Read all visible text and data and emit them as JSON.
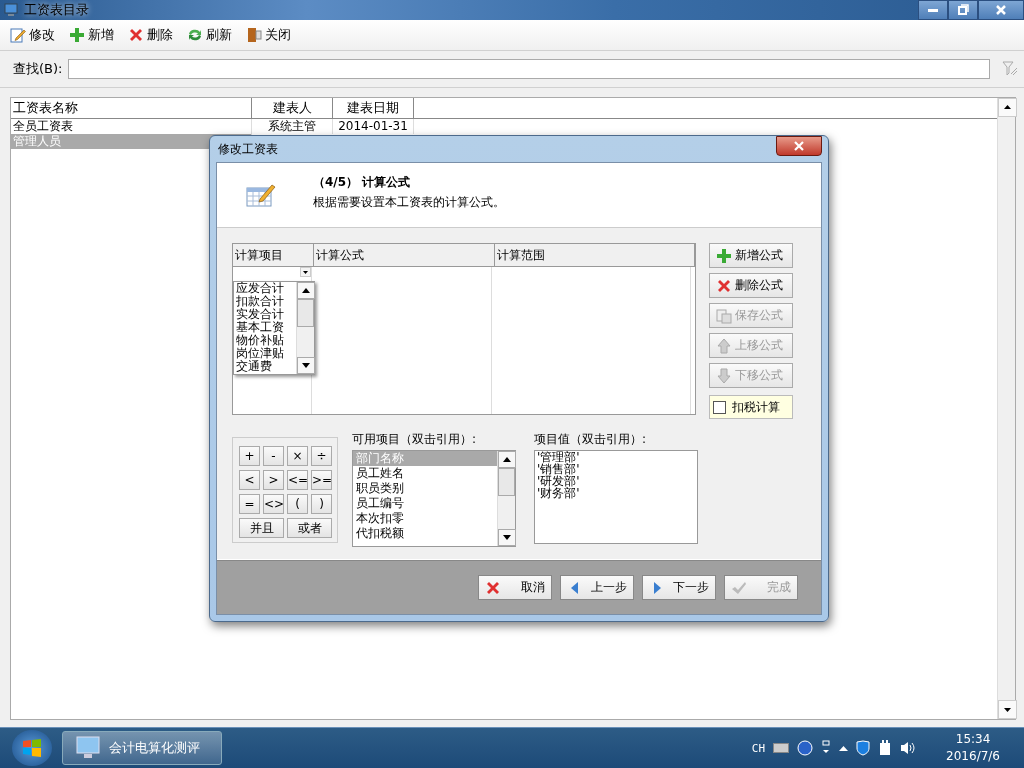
{
  "window": {
    "title": "工资表目录"
  },
  "toolbar": [
    {
      "label": "修改",
      "kind": "edit"
    },
    {
      "label": "新增",
      "kind": "add"
    },
    {
      "label": "删除",
      "kind": "delete"
    },
    {
      "label": "刷新",
      "kind": "refresh"
    },
    {
      "label": "关闭",
      "kind": "exit"
    }
  ],
  "search": {
    "label": "查找(B):"
  },
  "table": {
    "columns": [
      "工资表名称",
      "建表人",
      "建表日期"
    ],
    "rows": [
      {
        "cells": [
          "全员工资表",
          "系统主管",
          "2014-01-31"
        ],
        "selected": false
      },
      {
        "cells": [
          "管理人员"
        ],
        "selected": true
      }
    ]
  },
  "dialog": {
    "title": "修改工资表",
    "step": "（4/5） 计算公式",
    "description": "根据需要设置本工资表的计算公式。",
    "grid_columns": [
      "计算项目",
      "计算公式",
      "计算范围"
    ],
    "dropdown_items": [
      "应发合计",
      "扣款合计",
      "实发合计",
      "基本工资",
      "物价补贴",
      "岗位津贴",
      "交通费"
    ],
    "side_buttons": [
      {
        "label": "新增公式",
        "kind": "add",
        "disabled": false
      },
      {
        "label": "删除公式",
        "kind": "delete",
        "disabled": false
      },
      {
        "label": "保存公式",
        "kind": "save",
        "disabled": true
      },
      {
        "label": "上移公式",
        "kind": "up",
        "disabled": true
      },
      {
        "label": "下移公式",
        "kind": "down",
        "disabled": true
      }
    ],
    "tax_checkbox": {
      "label": "扣税计算",
      "checked": false
    },
    "operators": [
      "+",
      "-",
      "×",
      "÷",
      "<",
      ">",
      "<=",
      ">=",
      "=",
      "<>",
      "(",
      ")",
      "并且",
      "或者"
    ],
    "available_items": {
      "label": "可用项目（双击引用）:",
      "items": [
        {
          "text": "部门名称",
          "selected": true
        },
        {
          "text": "员工姓名",
          "selected": false
        },
        {
          "text": "职员类别",
          "selected": false
        },
        {
          "text": "员工编号",
          "selected": false
        },
        {
          "text": "本次扣零",
          "selected": false
        },
        {
          "text": "代扣税额",
          "selected": false
        }
      ]
    },
    "item_values": {
      "label": "项目值（双击引用）:",
      "items": [
        "'管理部'",
        "'销售部'",
        "'研发部'",
        "'财务部'"
      ]
    },
    "footer_buttons": [
      {
        "label": "取消",
        "kind": "cancel",
        "disabled": false
      },
      {
        "label": "上一步",
        "kind": "prev",
        "disabled": false
      },
      {
        "label": "下一步",
        "kind": "next",
        "disabled": false
      },
      {
        "label": "完成",
        "kind": "check",
        "disabled": true
      }
    ]
  },
  "taskbar": {
    "app": "会计电算化测评",
    "language": "CH",
    "time": "15:34",
    "date": "2016/7/6"
  }
}
